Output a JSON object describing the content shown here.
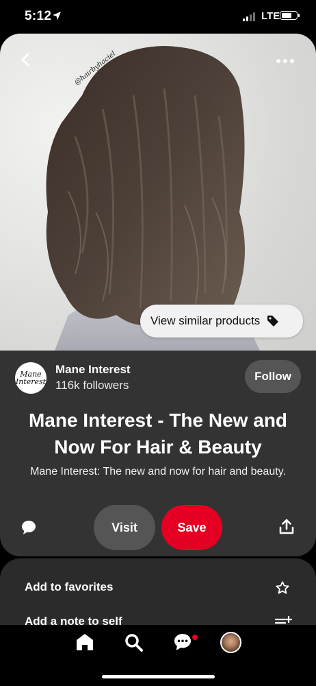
{
  "status_bar": {
    "time": "5:12",
    "network": "LTE"
  },
  "pin": {
    "image_watermark": "@hairbyhaciel",
    "similar_button_label": "View similar products",
    "creator": {
      "name": "Mane Interest",
      "followers": "116k followers",
      "avatar_text": [
        "Mane",
        "Interest"
      ]
    },
    "follow_label": "Follow",
    "title": "Mane Interest - The New and Now For Hair & Beauty",
    "description": "Mane Interest: The new and now for hair and beauty.",
    "visit_label": "Visit",
    "save_label": "Save"
  },
  "options": {
    "favorites_label": "Add to favorites",
    "note_label": "Add a note to self"
  },
  "colors": {
    "save_red": "#e50023",
    "card_bg": "#333333",
    "button_grey": "#555555"
  },
  "icons": {
    "back": "chevron-left-icon",
    "more": "more-dots-icon",
    "tag": "tag-icon",
    "comment": "comment-icon",
    "share": "share-icon",
    "star": "star-icon",
    "note": "add-note-icon",
    "home": "home-icon",
    "search": "search-icon",
    "chat": "chat-icon",
    "location": "location-arrow-icon"
  }
}
